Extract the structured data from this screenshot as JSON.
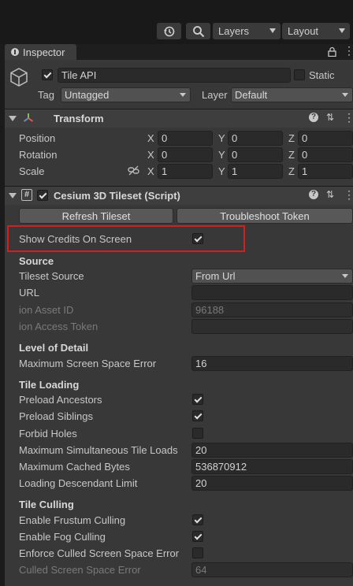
{
  "toolbar": {
    "history_icon": "history-icon",
    "search_icon": "search-icon",
    "layers_label": "Layers",
    "layout_label": "Layout"
  },
  "tab": {
    "title": "Inspector"
  },
  "object": {
    "enabled": true,
    "name": "Tile API",
    "static_label": "Static",
    "static": false,
    "tag_label": "Tag",
    "tag_value": "Untagged",
    "layer_label": "Layer",
    "layer_value": "Default"
  },
  "transform": {
    "title": "Transform",
    "rows": [
      {
        "label": "Position",
        "x": "0",
        "y": "0",
        "z": "0"
      },
      {
        "label": "Rotation",
        "x": "0",
        "y": "0",
        "z": "0"
      },
      {
        "label": "Scale",
        "x": "1",
        "y": "1",
        "z": "1"
      }
    ],
    "axis_x": "X",
    "axis_y": "Y",
    "axis_z": "Z"
  },
  "tileset": {
    "title": "Cesium 3D Tileset (Script)",
    "enabled": true,
    "refresh_button": "Refresh Tileset",
    "troubleshoot_button": "Troubleshoot Token",
    "show_credits_label": "Show Credits On Screen",
    "show_credits": true,
    "source_header": "Source",
    "tileset_source_label": "Tileset Source",
    "tileset_source_value": "From Url",
    "url_label": "URL",
    "url_value": "",
    "ion_asset_id_label": "ion Asset ID",
    "ion_asset_id_value": "96188",
    "ion_access_token_label": "ion Access Token",
    "ion_access_token_value": "",
    "lod_header": "Level of Detail",
    "max_sse_label": "Maximum Screen Space Error",
    "max_sse_value": "16",
    "loading_header": "Tile Loading",
    "preload_ancestors_label": "Preload Ancestors",
    "preload_siblings_label": "Preload Siblings",
    "forbid_holes_label": "Forbid Holes",
    "max_sim_loads_label": "Maximum Simultaneous Tile Loads",
    "max_sim_loads_value": "20",
    "max_cached_label": "Maximum Cached Bytes",
    "max_cached_value": "536870912",
    "loading_desc_label": "Loading Descendant Limit",
    "loading_desc_value": "20",
    "culling_header": "Tile Culling",
    "frustum_label": "Enable Frustum Culling",
    "fog_label": "Enable Fog Culling",
    "enforce_culled_label": "Enforce Culled Screen Space Error",
    "culled_sse_label": "Culled Screen Space Error",
    "culled_sse_value": "64"
  },
  "colors": {
    "highlight_border": "#d22020",
    "panel_bg": "#383838"
  }
}
